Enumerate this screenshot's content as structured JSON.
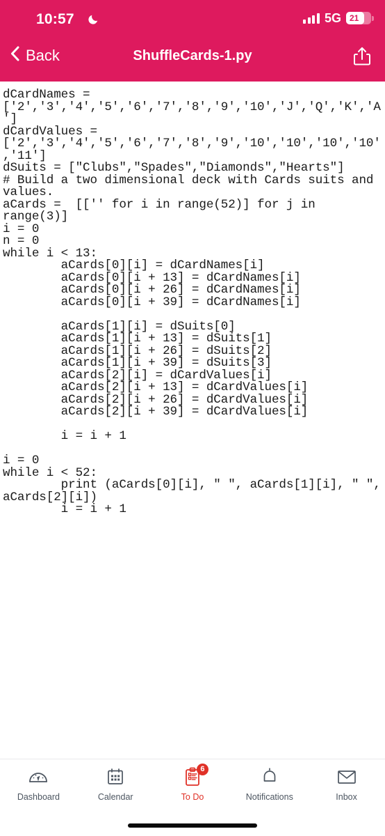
{
  "status_bar": {
    "time": "10:57",
    "moon_icon": "crescent-moon-icon",
    "signal_icon": "cellular-signal-icon",
    "network": "5G",
    "battery_level": "21",
    "battery_icon": "battery-icon"
  },
  "nav": {
    "back_label": "Back",
    "back_icon": "chevron-left-icon",
    "title": "ShuffleCards-1.py",
    "share_icon": "share-icon",
    "accent_color": "#DE1A5E"
  },
  "editor": {
    "language": "python",
    "code": "dCardNames =\n['2','3','4','5','6','7','8','9','10','J','Q','K','A\n']\ndCardValues =\n['2','3','4','5','6','7','8','9','10','10','10','10'\n,'11']\ndSuits = [\"Clubs\",\"Spades\",\"Diamonds\",\"Hearts\"]\n# Build a two dimensional deck with Cards suits and\nvalues.\naCards =  [['' for i in range(52)] for j in\nrange(3)]\ni = 0\nn = 0\nwhile i < 13:\n        aCards[0][i] = dCardNames[i]\n        aCards[0][i + 13] = dCardNames[i]\n        aCards[0][i + 26] = dCardNames[i]\n        aCards[0][i + 39] = dCardNames[i]\n\n        aCards[1][i] = dSuits[0]\n        aCards[1][i + 13] = dSuits[1]\n        aCards[1][i + 26] = dSuits[2]\n        aCards[1][i + 39] = dSuits[3]\n        aCards[2][i] = dCardValues[i]\n        aCards[2][i + 13] = dCardValues[i]\n        aCards[2][i + 26] = dCardValues[i]\n        aCards[2][i + 39] = dCardValues[i]\n\n        i = i + 1\n\ni = 0\nwhile i < 52:\n        print (aCards[0][i], \" \", aCards[1][i], \" \",\naCards[2][i])\n        i = i + 1"
  },
  "tabbar": {
    "active_color": "#E03127",
    "inactive_color": "#4C5560",
    "items": [
      {
        "label": "Dashboard",
        "icon": "gauge-icon",
        "active": false,
        "badge": ""
      },
      {
        "label": "Calendar",
        "icon": "calendar-icon",
        "active": false,
        "badge": ""
      },
      {
        "label": "To Do",
        "icon": "clipboard-checklist-icon",
        "active": true,
        "badge": "6"
      },
      {
        "label": "Notifications",
        "icon": "bell-icon",
        "active": false,
        "badge": ""
      },
      {
        "label": "Inbox",
        "icon": "envelope-icon",
        "active": false,
        "badge": ""
      }
    ]
  }
}
